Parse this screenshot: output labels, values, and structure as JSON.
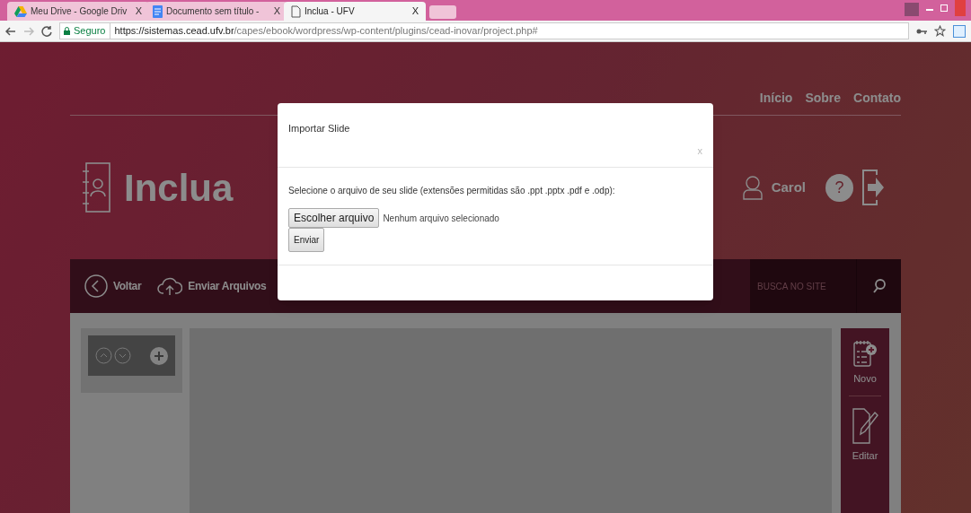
{
  "browser": {
    "tabs": [
      {
        "title": "Meu Drive - Google Driv",
        "close": "X",
        "selected": false
      },
      {
        "title": "Documento sem título - ",
        "close": "X",
        "selected": false
      },
      {
        "title": "Inclua - UFV",
        "close": "X",
        "selected": true
      }
    ],
    "secure_label": "Seguro",
    "url_host": "https://sistemas.cead.ufv.br",
    "url_path": "/capes/ebook/wordpress/wp-content/plugins/cead-inovar/project.php#"
  },
  "page": {
    "top_links": [
      "Início",
      "Sobre",
      "Contato"
    ],
    "brand": "Inclua",
    "user": "Carol",
    "help": "?",
    "toolbar": [
      {
        "label": "Voltar"
      },
      {
        "label": "Enviar Arquivos"
      }
    ],
    "search": {
      "placeholder": "BUSCA NO SITE"
    },
    "side_tools": [
      {
        "label": "Novo"
      },
      {
        "label": "Editar"
      }
    ]
  },
  "modal": {
    "title": "Importar Slide",
    "close": "x",
    "instructions": "Selecione o arquivo de seu slide (extensões permitidas são .ppt .pptx .pdf e .odp):",
    "file_button": "Escolher arquivo",
    "file_status": "Nenhum arquivo selecionado",
    "submit": "Enviar"
  }
}
